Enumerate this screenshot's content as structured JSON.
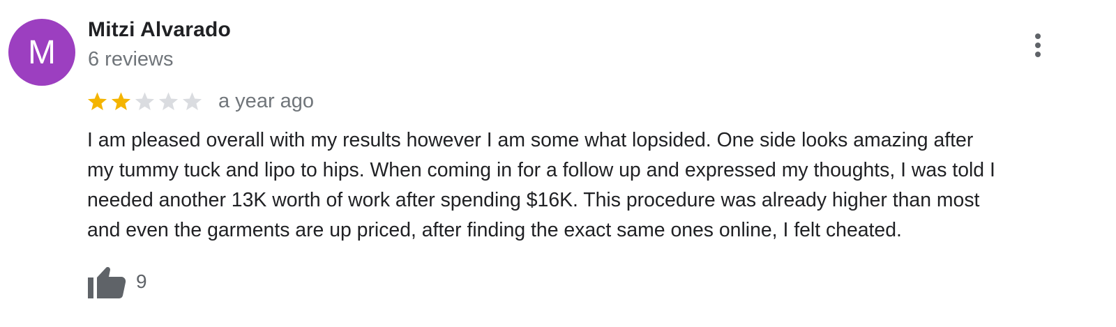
{
  "author": {
    "initial": "M",
    "name": "Mitzi Alvarado",
    "review_count": "6 reviews",
    "avatar_color": "#9c3fc0"
  },
  "rating": {
    "value": 2,
    "max": 5,
    "filled_color": "#f4b400",
    "empty_color": "#dadce0"
  },
  "date": "a year ago",
  "review_text": "I am pleased overall with my results however I am some what lopsided. One side looks amazing after\nmy tummy tuck and lipo to hips. When coming in for a follow up and expressed my thoughts, I was told I\nneeded another 13K worth of work after spending $16K.  This procedure was already higher than most\nand even the garments are up priced, after finding the exact same ones online, I felt cheated.",
  "likes": {
    "count": "9",
    "icon": "thumbs-up-icon"
  },
  "menu": {
    "icon": "more-vert-icon"
  }
}
